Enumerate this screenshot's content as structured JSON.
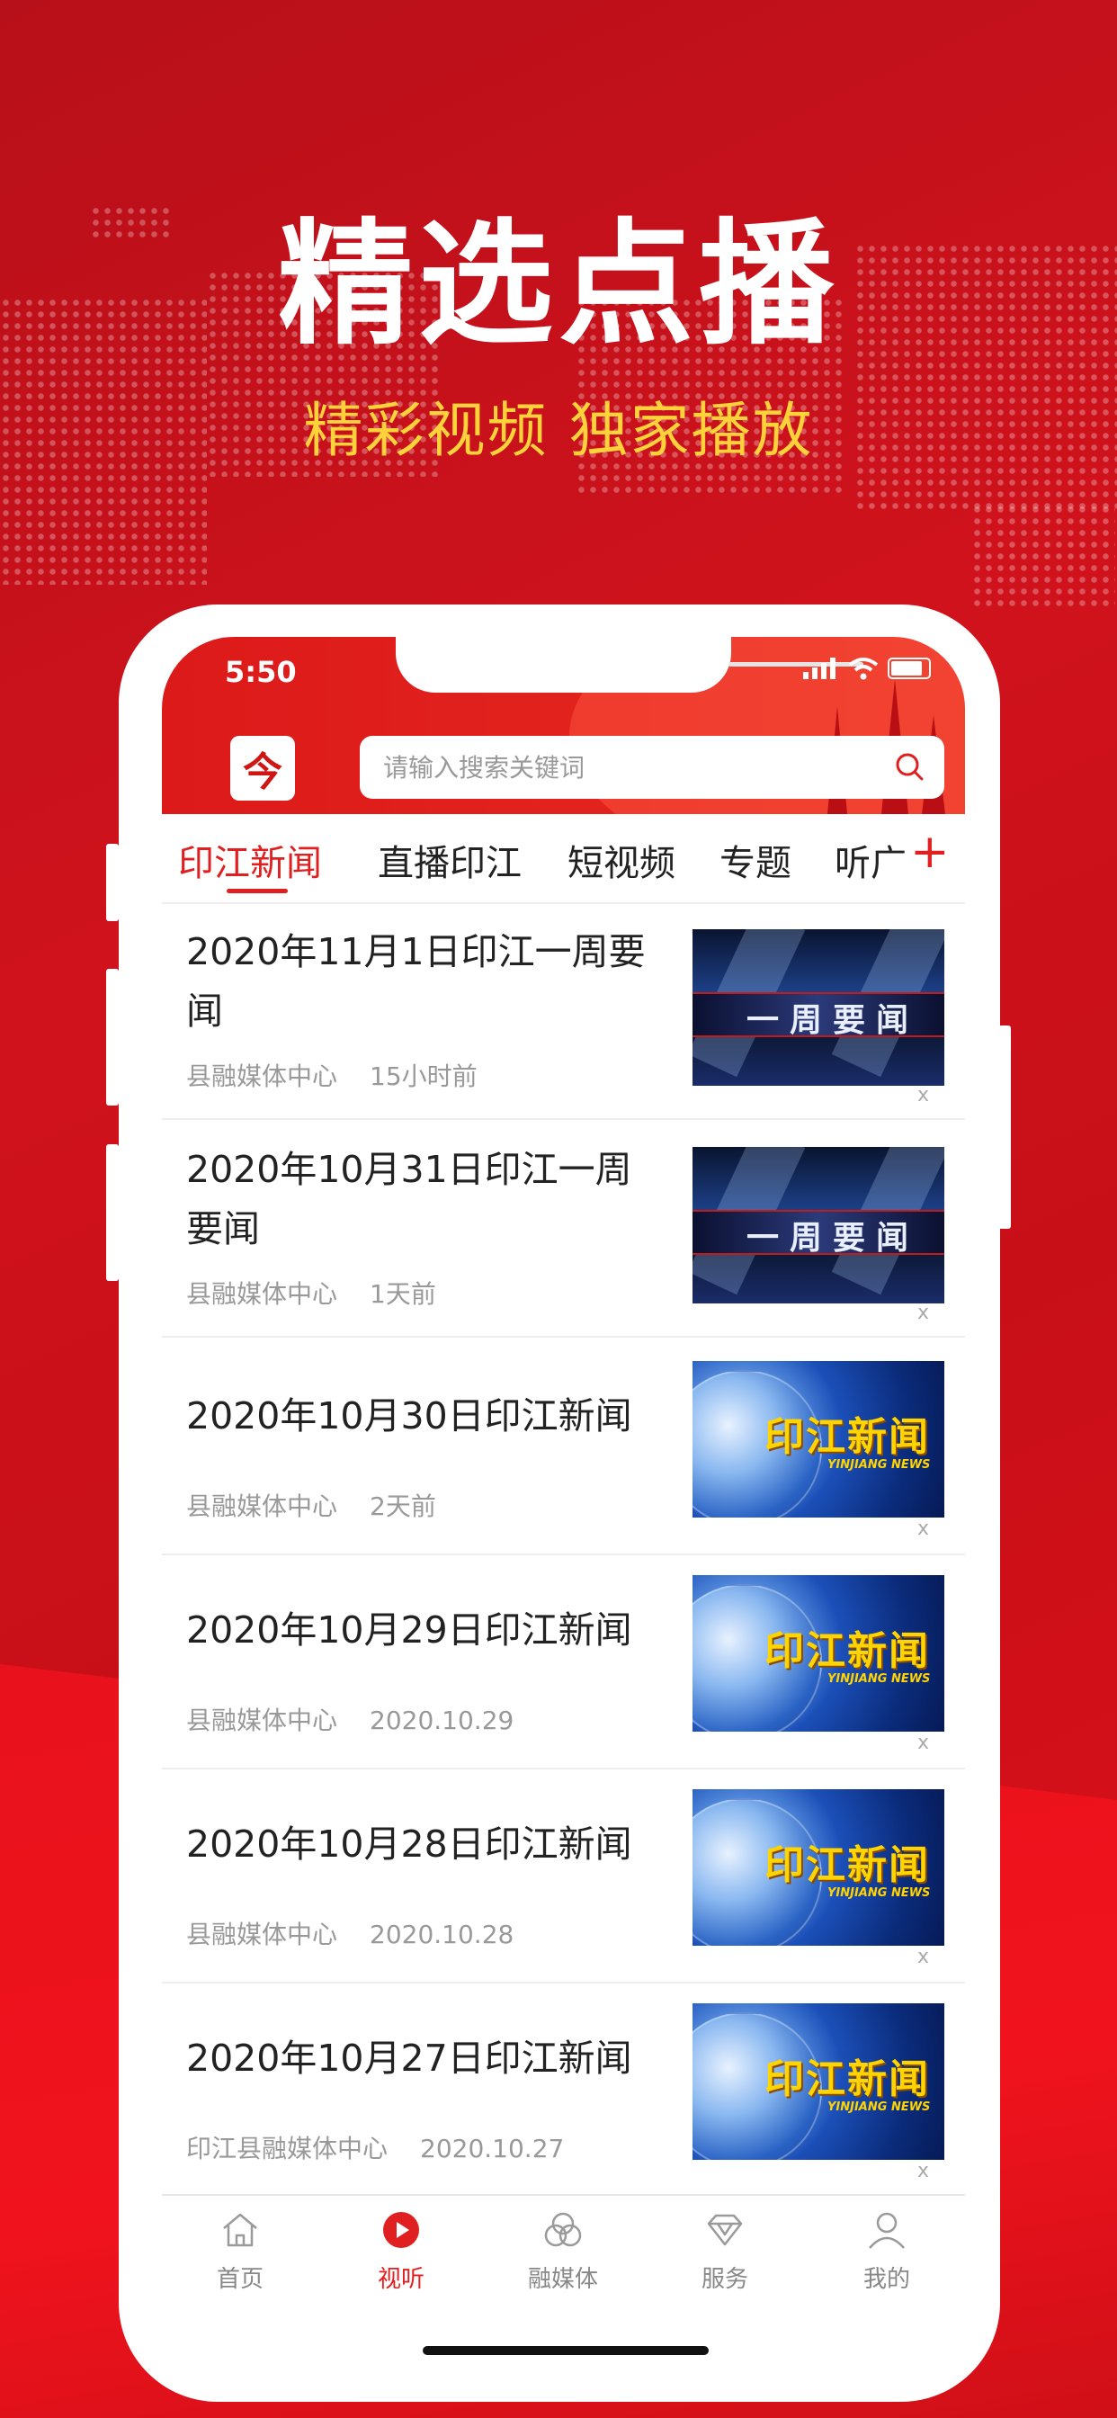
{
  "promo": {
    "title": "精选点播",
    "subtitle": "精彩视频 独家播放"
  },
  "status_bar": {
    "time": "5:50"
  },
  "header": {
    "logo_icon": "app-logo-icon",
    "search_placeholder": "请输入搜索关键词"
  },
  "tabs": [
    {
      "label": "印江新闻",
      "active": true
    },
    {
      "label": "直播印江",
      "active": false
    },
    {
      "label": "短视频",
      "active": false
    },
    {
      "label": "专题",
      "active": false
    },
    {
      "label": "听广",
      "active": false
    }
  ],
  "tab_add_label": "+",
  "news": [
    {
      "title": "2020年11月1日印江一周要闻",
      "source": "县融媒体中心",
      "time": "15小时前",
      "thumb": "weekly",
      "close": "x"
    },
    {
      "title": "2020年10月31日印江一周要闻",
      "source": "县融媒体中心",
      "time": "1天前",
      "thumb": "weekly",
      "close": "x"
    },
    {
      "title": "2020年10月30日印江新闻",
      "source": "县融媒体中心",
      "time": "2天前",
      "thumb": "news",
      "close": "x"
    },
    {
      "title": "2020年10月29日印江新闻",
      "source": "县融媒体中心",
      "time": "2020.10.29",
      "thumb": "news",
      "close": "x"
    },
    {
      "title": "2020年10月28日印江新闻",
      "source": "县融媒体中心",
      "time": "2020.10.28",
      "thumb": "news",
      "close": "x"
    },
    {
      "title": "2020年10月27日印江新闻",
      "source": "印江县融媒体中心",
      "time": "2020.10.27",
      "thumb": "news",
      "close": "x"
    }
  ],
  "thumb_text": {
    "weekly": "一周要闻",
    "news": "印江新闻",
    "news_en": "YINJIANG NEWS"
  },
  "tabbar": [
    {
      "label": "首页",
      "icon": "home-icon",
      "active": false
    },
    {
      "label": "视听",
      "icon": "play-icon",
      "active": true
    },
    {
      "label": "融媒体",
      "icon": "media-icon",
      "active": false
    },
    {
      "label": "服务",
      "icon": "diamond-icon",
      "active": false
    },
    {
      "label": "我的",
      "icon": "user-icon",
      "active": false
    }
  ],
  "colors": {
    "brand_red": "#e02020",
    "promo_yellow": "#ffd23a"
  }
}
